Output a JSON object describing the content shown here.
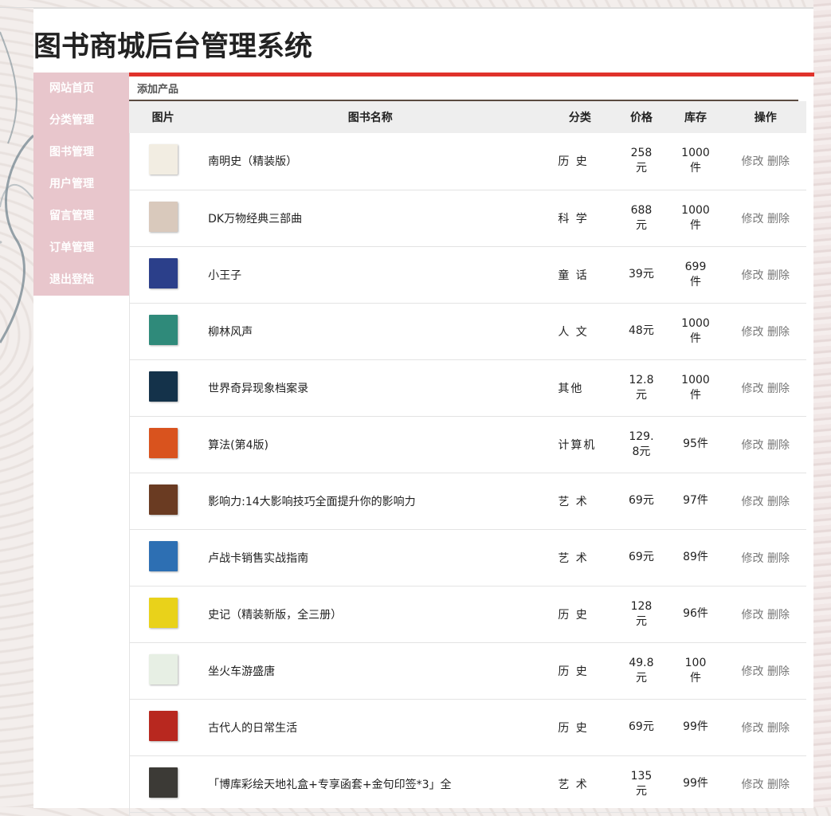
{
  "title": "图书商城后台管理系统",
  "sidebar": {
    "items": [
      {
        "label": "网站首页"
      },
      {
        "label": "分类管理"
      },
      {
        "label": "图书管理"
      },
      {
        "label": "用户管理"
      },
      {
        "label": "留言管理"
      },
      {
        "label": "订单管理"
      },
      {
        "label": "退出登陆"
      }
    ]
  },
  "toolbar": {
    "add_label": "添加产品"
  },
  "table": {
    "headers": {
      "image": "图片",
      "name": "图书名称",
      "category": "分类",
      "price": "价格",
      "stock": "库存",
      "action": "操作"
    },
    "edit_label": "修改",
    "delete_label": "删除",
    "rows": [
      {
        "name": "南明史（精装版）",
        "category": "历 史",
        "price": "258元",
        "stock": "1000件",
        "cover_color": "#f2ede2"
      },
      {
        "name": "DK万物经典三部曲",
        "category": "科 学",
        "price": "688元",
        "stock": "1000件",
        "cover_color": "#d9c9bc"
      },
      {
        "name": "小王子",
        "category": "童 话",
        "price": "39元",
        "stock": "699件",
        "cover_color": "#2b3f8a"
      },
      {
        "name": "柳林风声",
        "category": "人 文",
        "price": "48元",
        "stock": "1000件",
        "cover_color": "#2f8a7a"
      },
      {
        "name": "世界奇异现象档案录",
        "category": "其他",
        "price": "12.8元",
        "stock": "1000件",
        "cover_color": "#14324a"
      },
      {
        "name": "算法(第4版)",
        "category": "计算机",
        "price": "129.8元",
        "stock": "95件",
        "cover_color": "#d9531e"
      },
      {
        "name": "影响力:14大影响技巧全面提升你的影响力",
        "category": "艺 术",
        "price": "69元",
        "stock": "97件",
        "cover_color": "#6a3b22"
      },
      {
        "name": "卢战卡销售实战指南",
        "category": "艺 术",
        "price": "69元",
        "stock": "89件",
        "cover_color": "#2d6fb3"
      },
      {
        "name": "史记（精装新版，全三册）",
        "category": "历 史",
        "price": "128元",
        "stock": "96件",
        "cover_color": "#e9d21a"
      },
      {
        "name": "坐火车游盛唐",
        "category": "历 史",
        "price": "49.8元",
        "stock": "100件",
        "cover_color": "#e7efe4"
      },
      {
        "name": "古代人的日常生活",
        "category": "历 史",
        "price": "69元",
        "stock": "99件",
        "cover_color": "#b8281f"
      },
      {
        "name": "「博库彩绘天地礼盒+专享函套+金句印签*3」全",
        "category": "艺 术",
        "price": "135元",
        "stock": "99件",
        "cover_color": "#3c3a36"
      }
    ]
  }
}
